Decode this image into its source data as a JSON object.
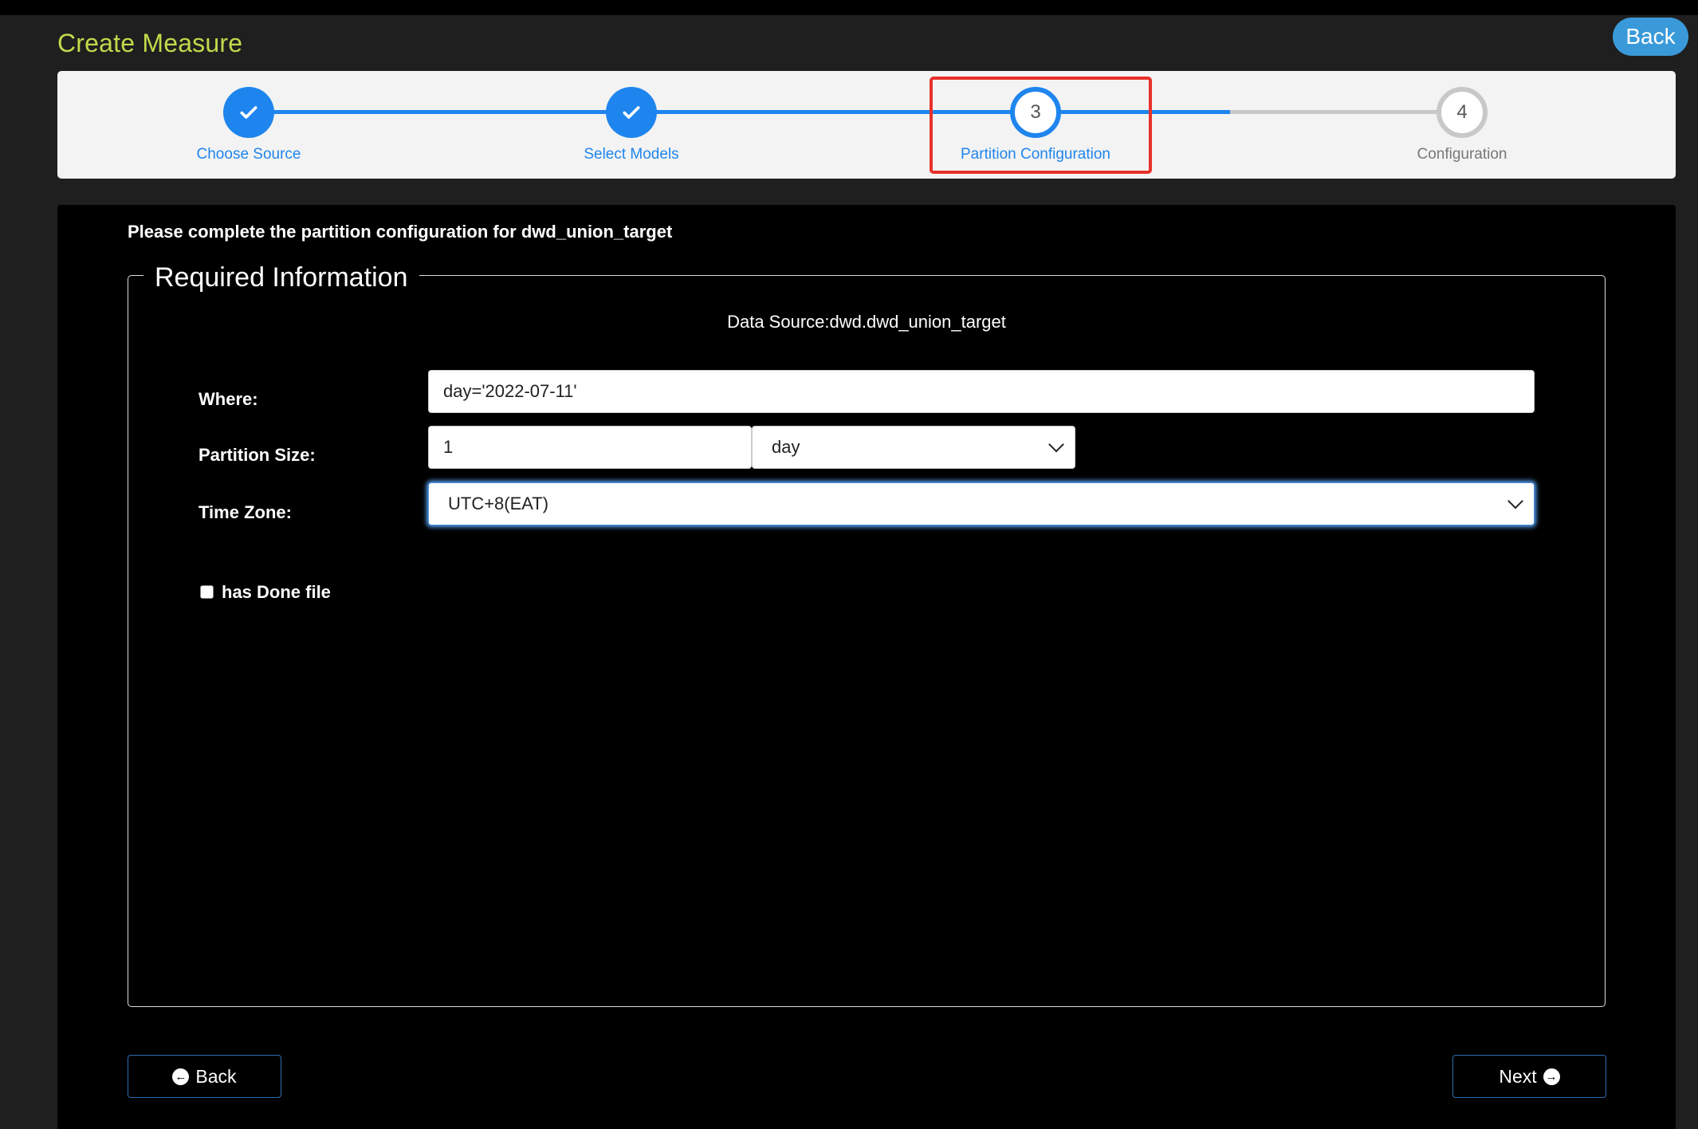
{
  "header": {
    "title": "Create Measure",
    "back_label": "Back"
  },
  "stepper": {
    "steps": [
      {
        "number": "1",
        "label": "Choose Source",
        "status": "done"
      },
      {
        "number": "2",
        "label": "Select Models",
        "status": "done"
      },
      {
        "number": "3",
        "label": "Partition Configuration",
        "status": "active"
      },
      {
        "number": "4",
        "label": "Configuration",
        "status": "todo"
      }
    ]
  },
  "main": {
    "instructions": "Please complete the partition configuration for dwd_union_target",
    "legend": "Required Information",
    "data_source": "Data Source:dwd.dwd_union_target",
    "where": {
      "label": "Where:",
      "value": "day='2022-07-11'"
    },
    "partition_size": {
      "label": "Partition Size:",
      "value": "1",
      "unit": "day"
    },
    "time_zone": {
      "label": "Time Zone:",
      "value": "UTC+8(EAT)"
    },
    "has_done_file": {
      "label": "has Done file",
      "checked": false
    },
    "back_button": "Back",
    "next_button": "Next"
  },
  "colors": {
    "accent": "#1f85ee",
    "title": "#c2d94b",
    "highlight": "#e8312a",
    "back_pill": "#3a9ad9"
  }
}
